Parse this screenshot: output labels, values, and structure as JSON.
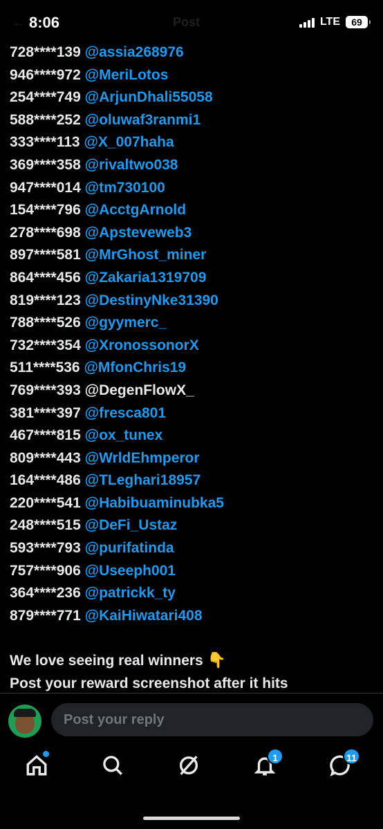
{
  "status": {
    "time": "8:06",
    "network": "LTE",
    "battery": "69",
    "faded_title": "Post"
  },
  "entries": [
    {
      "id": "728****139",
      "handle": "@assia268976"
    },
    {
      "id": "946****972",
      "handle": "@MeriLotos"
    },
    {
      "id": "254****749",
      "handle": "@ArjunDhali55058"
    },
    {
      "id": "588****252",
      "handle": "@oluwaf3ranmi1"
    },
    {
      "id": "333****113",
      "handle": "@X_007haha"
    },
    {
      "id": "369****358",
      "handle": "@rivaltwo038"
    },
    {
      "id": "947****014",
      "handle": "@tm730100"
    },
    {
      "id": "154****796",
      "handle": "@AcctgArnold"
    },
    {
      "id": "278****698",
      "handle": "@Apsteveweb3"
    },
    {
      "id": "897****581",
      "handle": "@MrGhost_miner"
    },
    {
      "id": "864****456",
      "handle": "@Zakaria1319709"
    },
    {
      "id": "819****123",
      "handle": "@DestinyNke31390"
    },
    {
      "id": "788****526",
      "handle": "@gyymerc_"
    },
    {
      "id": "732****354",
      "handle": "@XronossonorX"
    },
    {
      "id": "511****536",
      "handle": "@MfonChris19"
    },
    {
      "id": "769****393",
      "handle": "@DegenFlowX_"
    },
    {
      "id": "381****397",
      "handle": "@fresca801"
    },
    {
      "id": "467****815",
      "handle": "@ox_tunex"
    },
    {
      "id": "809****443",
      "handle": "@WrldEhmperor"
    },
    {
      "id": "164****486",
      "handle": "@TLeghari18957"
    },
    {
      "id": "220****541",
      "handle": "@Habibuaminubka5"
    },
    {
      "id": "248****515",
      "handle": "@DeFi_Ustaz"
    },
    {
      "id": "593****793",
      "handle": "@purifatinda"
    },
    {
      "id": "757****906",
      "handle": "@Useeph001"
    },
    {
      "id": "364****236",
      "handle": "@patrickk_ty"
    },
    {
      "id": "879****771",
      "handle": "@KaiHiwatari408"
    }
  ],
  "message": {
    "line1": "We love seeing real winners",
    "emoji": "👇",
    "line2": "Post your reward screenshot after it hits"
  },
  "reply": {
    "placeholder": "Post your reply"
  },
  "tabs": {
    "notifications_badge": "1",
    "messages_badge": "11"
  },
  "colors": {
    "link": "#1d9bf0",
    "text": "#e7e9ea",
    "background": "#000000"
  }
}
